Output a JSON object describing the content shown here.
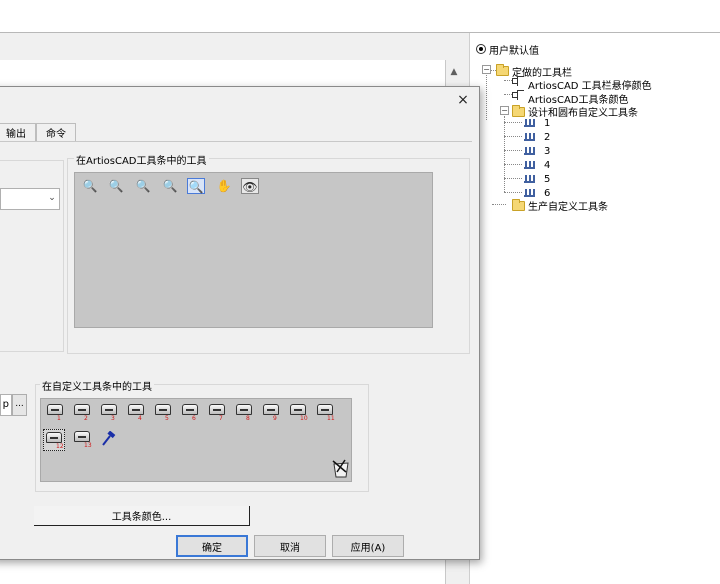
{
  "tree": {
    "root_radio_label": "用户默认值",
    "nodes": [
      {
        "label": "定做的工具栏"
      },
      {
        "label": "ArtiosCAD 工具栏悬停颜色"
      },
      {
        "label": "ArtiosCAD工具条颜色"
      },
      {
        "label": "设计和圆布自定义工具条"
      },
      {
        "label": "1"
      },
      {
        "label": "2"
      },
      {
        "label": "3"
      },
      {
        "label": "4"
      },
      {
        "label": "5"
      },
      {
        "label": "6"
      },
      {
        "label": "生产自定义工具条"
      }
    ],
    "expander_minus": "−"
  },
  "dialog": {
    "close_glyph": "×",
    "tabs": [
      {
        "label": "输出"
      },
      {
        "label": "命令"
      }
    ],
    "artios_group_title": "在ArtiosCAD工具条中的工具",
    "custom_group_title": "在自定义工具条中的工具",
    "combo_arrow": "⌄",
    "small_edit_value": "p",
    "ellipsis_label": "...",
    "toolbar_color_button": "工具条颜色...",
    "ok_button": "确定",
    "cancel_button": "取消",
    "apply_button": "应用(A)",
    "artios_tools": [
      {
        "icon": "zoom-in-icon",
        "glyph": "🔍"
      },
      {
        "icon": "zoom-in-window-icon",
        "glyph": "🔍"
      },
      {
        "icon": "zoom-out-icon",
        "glyph": "🔍"
      },
      {
        "icon": "zoom-extents-icon",
        "glyph": "🔍"
      },
      {
        "icon": "zoom-selection-icon",
        "glyph": "🔍"
      },
      {
        "icon": "pan-hand-icon",
        "glyph": "✋"
      },
      {
        "icon": "view-eye-icon",
        "glyph": "👁"
      }
    ],
    "custom_tools": [
      {
        "num": "1"
      },
      {
        "num": "2"
      },
      {
        "num": "3"
      },
      {
        "num": "4"
      },
      {
        "num": "5"
      },
      {
        "num": "6"
      },
      {
        "num": "7"
      },
      {
        "num": "8"
      },
      {
        "num": "9"
      },
      {
        "num": "10"
      },
      {
        "num": "11"
      },
      {
        "num": "12"
      },
      {
        "num": "13"
      }
    ],
    "scroll_up_glyph": "▲"
  }
}
